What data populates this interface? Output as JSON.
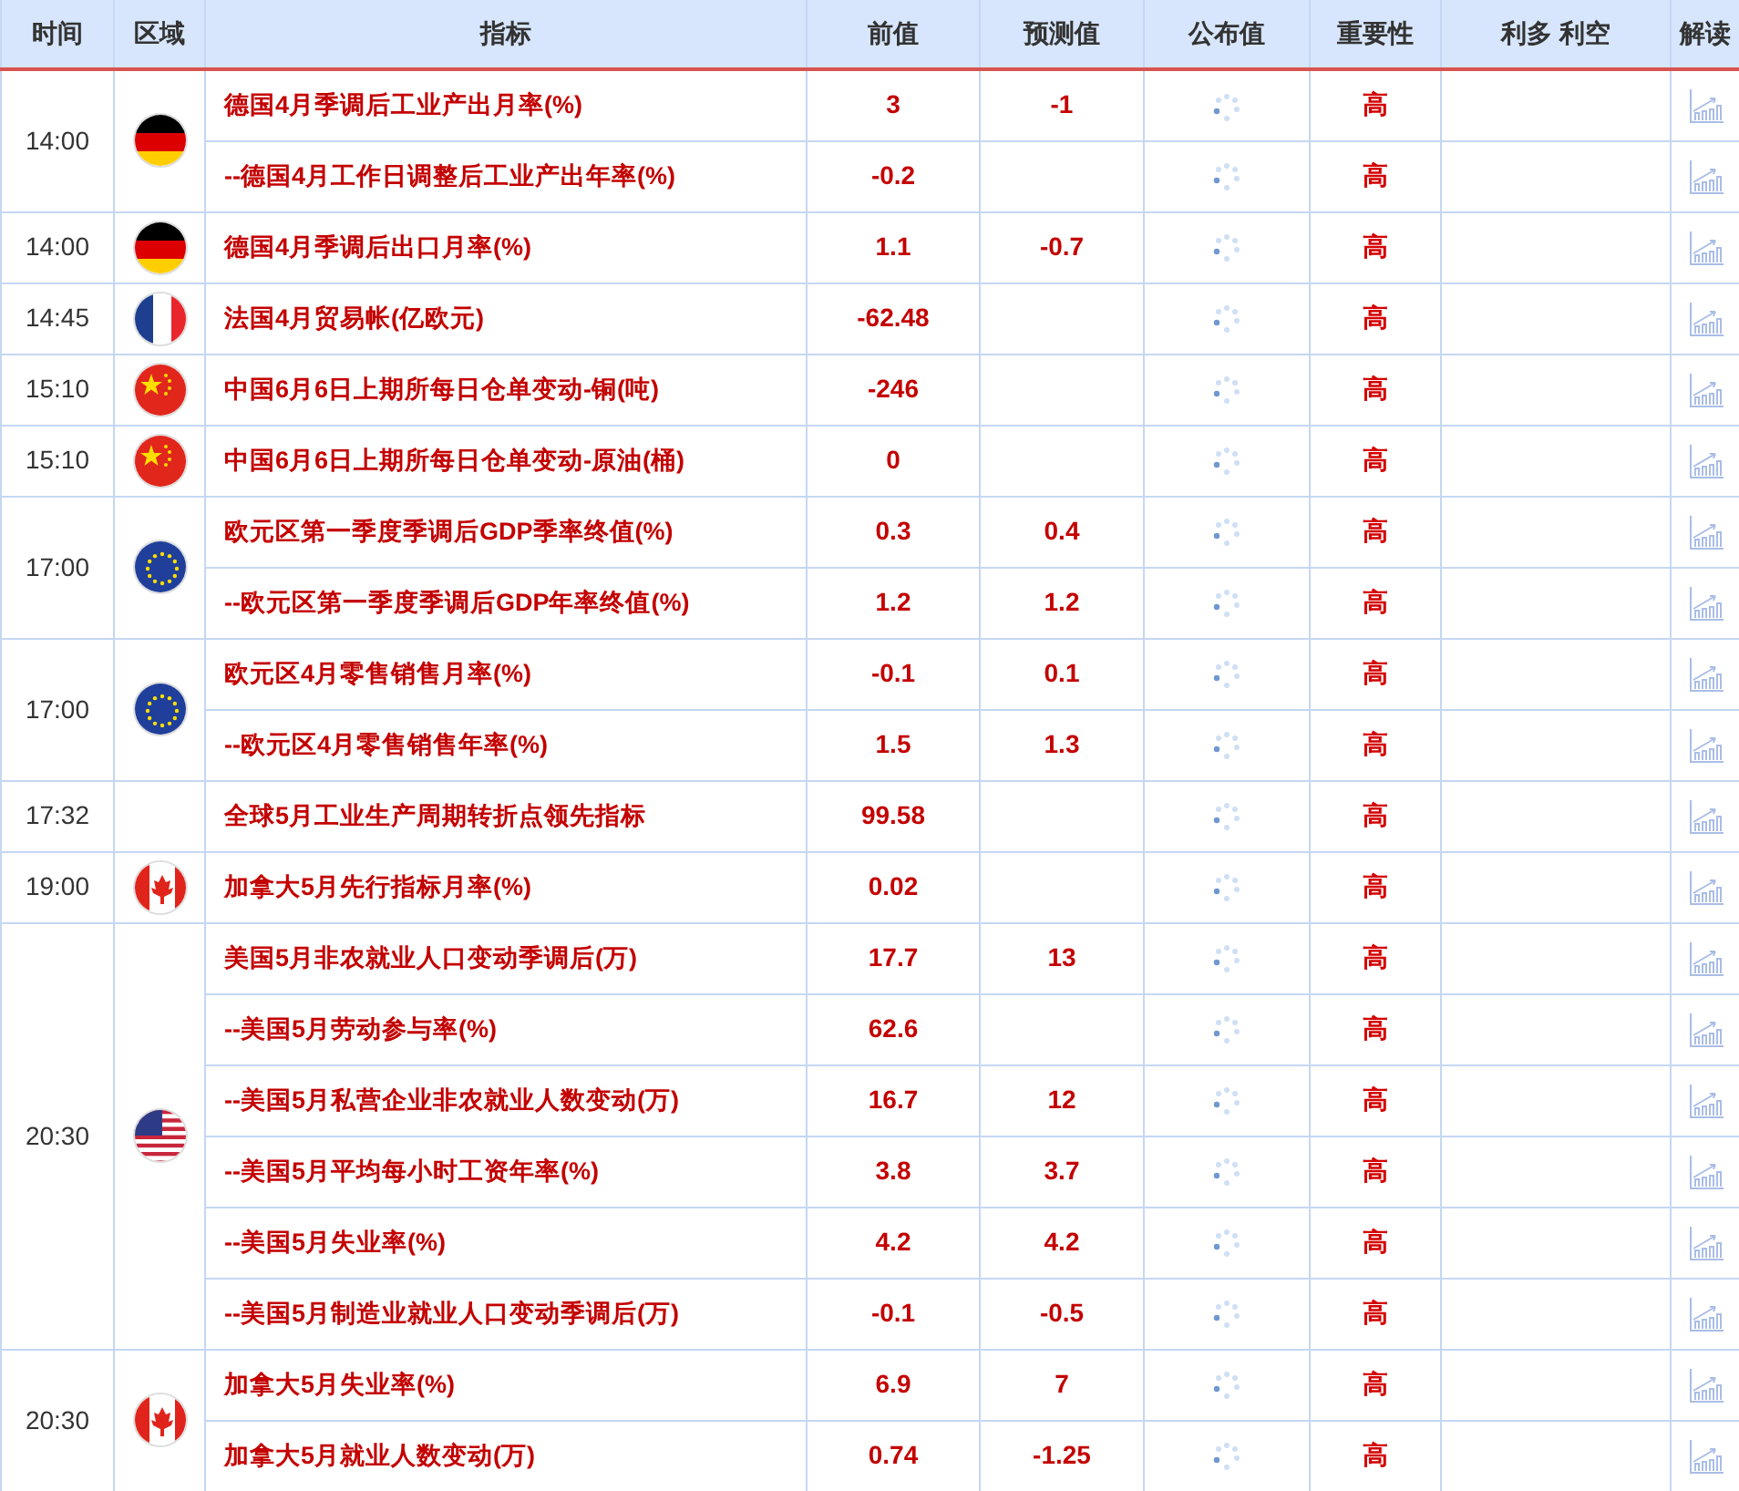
{
  "columns": [
    "时间",
    "区域",
    "指标",
    "前值",
    "预测值",
    "公布值",
    "重要性",
    "利多 利空",
    "解读"
  ],
  "groups": [
    {
      "time": "14:00",
      "kind": "de",
      "rows": [
        {
          "indicator": "德国4月季调后工业产出月率(%)",
          "previous": "3",
          "forecast": "-1",
          "importance": "高"
        },
        {
          "indicator": "--德国4月工作日调整后工业产出年率(%)",
          "previous": "-0.2",
          "importance": "高"
        }
      ]
    },
    {
      "time": "14:00",
      "kind": "de",
      "rows": [
        {
          "indicator": "德国4月季调后出口月率(%)",
          "previous": "1.1",
          "forecast": "-0.7",
          "importance": "高"
        }
      ]
    },
    {
      "time": "14:45",
      "kind": "fr",
      "rows": [
        {
          "indicator": "法国4月贸易帐(亿欧元)",
          "previous": "-62.48",
          "importance": "高"
        }
      ]
    },
    {
      "time": "15:10",
      "kind": "cn",
      "rows": [
        {
          "indicator": "中国6月6日上期所每日仓单变动-铜(吨)",
          "previous": "-246",
          "importance": "高"
        }
      ]
    },
    {
      "time": "15:10",
      "kind": "cn",
      "rows": [
        {
          "indicator": "中国6月6日上期所每日仓单变动-原油(桶)",
          "previous": "0",
          "importance": "高"
        }
      ]
    },
    {
      "time": "17:00",
      "kind": "eu",
      "rows": [
        {
          "indicator": "欧元区第一季度季调后GDP季率终值(%)",
          "previous": "0.3",
          "forecast": "0.4",
          "importance": "高"
        },
        {
          "indicator": "--欧元区第一季度季调后GDP年率终值(%)",
          "previous": "1.2",
          "forecast": "1.2",
          "importance": "高"
        }
      ]
    },
    {
      "time": "17:00",
      "kind": "eu",
      "rows": [
        {
          "indicator": "欧元区4月零售销售月率(%)",
          "previous": "-0.1",
          "forecast": "0.1",
          "importance": "高"
        },
        {
          "indicator": "--欧元区4月零售销售年率(%)",
          "previous": "1.5",
          "forecast": "1.3",
          "importance": "高"
        }
      ]
    },
    {
      "time": "17:32",
      "rows": [
        {
          "indicator": "全球5月工业生产周期转折点领先指标",
          "previous": "99.58",
          "importance": "高"
        }
      ]
    },
    {
      "time": "19:00",
      "kind": "ca",
      "rows": [
        {
          "indicator": "加拿大5月先行指标月率(%)",
          "previous": "0.02",
          "importance": "高"
        }
      ]
    },
    {
      "time": "20:30",
      "kind": "us",
      "rows": [
        {
          "indicator": "美国5月非农就业人口变动季调后(万)",
          "previous": "17.7",
          "forecast": "13",
          "importance": "高"
        },
        {
          "indicator": "--美国5月劳动参与率(%)",
          "previous": "62.6",
          "importance": "高"
        },
        {
          "indicator": "--美国5月私营企业非农就业人数变动(万)",
          "previous": "16.7",
          "forecast": "12",
          "importance": "高"
        },
        {
          "indicator": "--美国5月平均每小时工资年率(%)",
          "previous": "3.8",
          "forecast": "3.7",
          "importance": "高"
        },
        {
          "indicator": "--美国5月失业率(%)",
          "previous": "4.2",
          "forecast": "4.2",
          "importance": "高"
        },
        {
          "indicator": "--美国5月制造业就业人口变动季调后(万)",
          "previous": "-0.1",
          "forecast": "-0.5",
          "importance": "高"
        }
      ]
    },
    {
      "time": "20:30",
      "kind": "ca",
      "rows": [
        {
          "indicator": "加拿大5月失业率(%)",
          "previous": "6.9",
          "forecast": "7",
          "importance": "高"
        },
        {
          "indicator": "加拿大5月就业人数变动(万)",
          "previous": "0.74",
          "forecast": "-1.25",
          "importance": "高"
        }
      ]
    }
  ]
}
